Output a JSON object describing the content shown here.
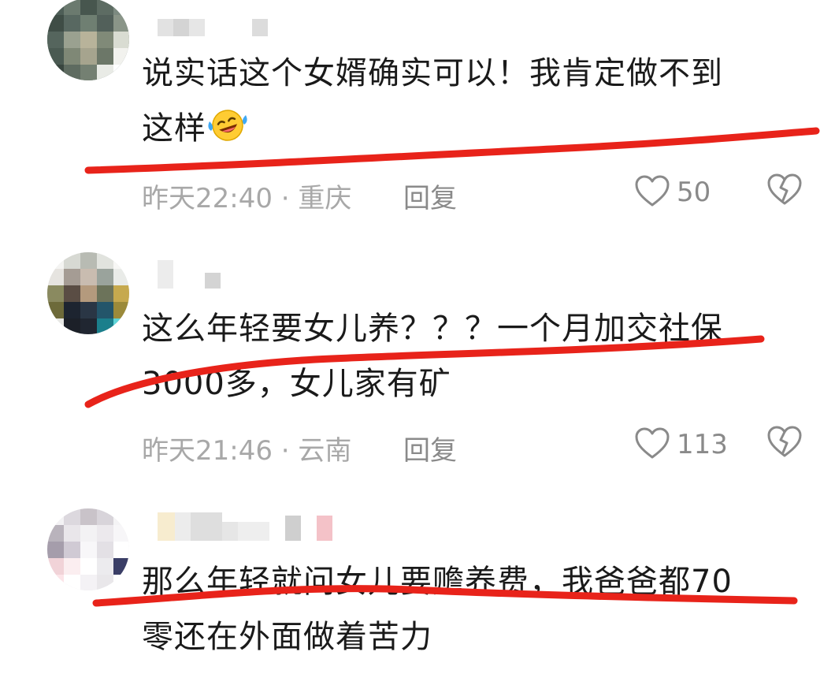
{
  "comments": [
    {
      "text_line1": "说实话这个女婿确实可以！我肯定做不到",
      "text_line2": "这样",
      "emoji": "laughing-tears-emoji",
      "time_location": "昨天22:40 · 重庆",
      "reply_label": "回复",
      "likes": "50"
    },
    {
      "text_line1": "这么年轻要女儿养？？？一个月加交社保",
      "text_line2": "3000多，女儿家有矿",
      "time_location": "昨天21:46 · 云南",
      "reply_label": "回复",
      "likes": "113"
    },
    {
      "text_line1": "那么年轻就问女儿要赡养费，我爸爸都70",
      "text_line2": "零还在外面做着苦力"
    }
  ],
  "icons": {
    "like": "heart-outline-icon",
    "dislike": "broken-heart-icon"
  },
  "colors": {
    "annotation_line": "#e8231a",
    "meta_text": "#a8a8a8",
    "body_text": "#1a1a1a"
  }
}
